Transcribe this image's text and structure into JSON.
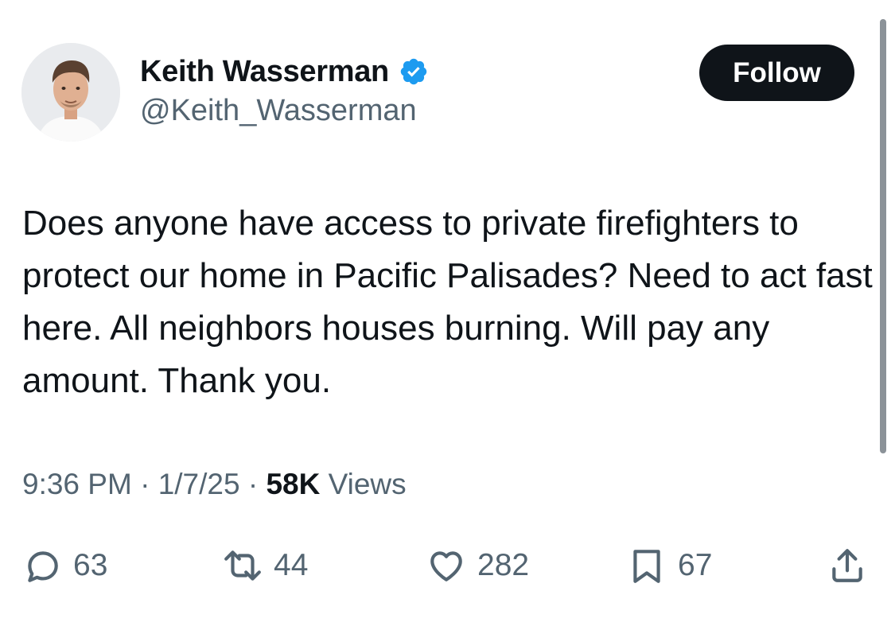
{
  "author": {
    "display_name": "Keith Wasserman",
    "handle": "@Keith_Wasserman",
    "verified": true,
    "avatar_icon": "profile-photo"
  },
  "follow_button": {
    "label": "Follow"
  },
  "tweet": {
    "text": "Does anyone have access to private firefighters to protect our home in Pacific Palisades? Need to act fast here. All neighbors houses burning. Will pay any amount. Thank you."
  },
  "meta": {
    "time": "9:36 PM",
    "date": "1/7/25",
    "separator": "·",
    "views_count": "58K",
    "views_label": "Views"
  },
  "actions": {
    "replies": "63",
    "reposts": "44",
    "likes": "282",
    "bookmarks": "67"
  },
  "colors": {
    "text_primary": "#0f1419",
    "text_secondary": "#536471",
    "verified_blue": "#1d9bf0",
    "follow_bg": "#0f1419",
    "scrollbar": "#8b9298"
  }
}
